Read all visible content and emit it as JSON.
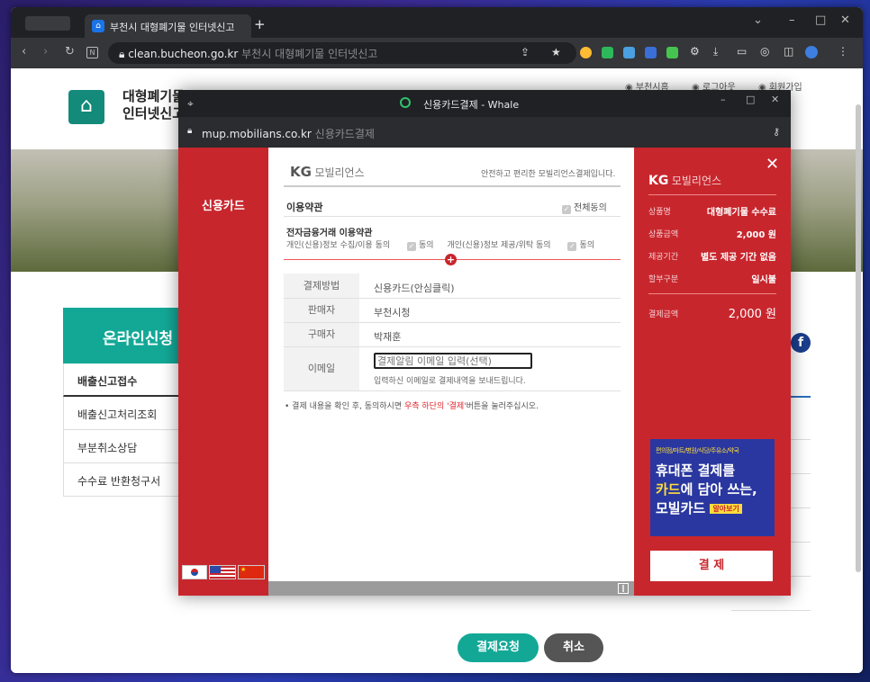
{
  "browser": {
    "tab_title": "부천시 대형폐기물 인터넷신고",
    "new_tab": "+",
    "url_host": "clean.bucheon.go.kr",
    "url_title": "부천시 대형폐기물 인터넷신고"
  },
  "site": {
    "logo_line1": "대형폐기물",
    "logo_line2": "인터넷신고",
    "header_links": [
      "부천시홈",
      "로그아웃",
      "회원가입"
    ],
    "sidebar_title": "온라인신청",
    "sidebar_items": [
      "배출신고접수",
      "배출신고처리조회",
      "부분취소상담",
      "수수료 반환청구서"
    ],
    "btn_pay_request": "결제요청",
    "btn_cancel": "취소"
  },
  "popup": {
    "window_title": "신용카드결제 - Whale",
    "url_host": "mup.mobilians.co.kr",
    "url_title": "신용카드결제",
    "left_menu": "신용카드",
    "brand": "모빌리언스",
    "brand_kg": "KG",
    "slogan": "안전하고 편리한 모빌리언스결제입니다.",
    "terms_title": "이용약관",
    "agree_all": "전체동의",
    "ef_terms": "전자금융거래 이용약관",
    "privacy_collect": "개인(신용)정보 수집/이용 동의",
    "privacy_provide": "개인(신용)정보 제공/위탁 동의",
    "agree": "동의",
    "rows": [
      {
        "label": "결제방법",
        "value": "신용카드(안심클릭)"
      },
      {
        "label": "판매자",
        "value": "부천시청"
      },
      {
        "label": "구매자",
        "value": "박재훈"
      }
    ],
    "email_label": "이메일",
    "email_placeholder": "결제알림 이메일 입력(선택)",
    "email_help": "입력하신 이메일로 결제내역을 보내드립니다.",
    "notice_pre": "• 결제 내용을 확인 후, 동의하시면 ",
    "notice_red": "우측 하단의 '결제'",
    "notice_post": "버튼을 눌러주십시오.",
    "summary": [
      {
        "label": "상품명",
        "value": "대형폐기물 수수료"
      },
      {
        "label": "상품금액",
        "value": "2,000 원"
      },
      {
        "label": "제공기간",
        "value": "별도 제공 기간 없음"
      },
      {
        "label": "할부구분",
        "value": "일시불"
      }
    ],
    "total_label": "결제금액",
    "total_value": "2,000 원",
    "ad_small": "편의점/마트/병원/식당/주유소/약국",
    "ad_line1": "휴대폰 결제를",
    "ad_line2_a": "카드",
    "ad_line2_b": "에 담아 쓰는,",
    "ad_line3": "모빌카드",
    "ad_more": "알아보기",
    "pay_button": "결 제"
  },
  "colors": {
    "popup_red": "#c8262d",
    "site_teal": "#13a896",
    "pay_request": "#13a896",
    "cancel": "#555555"
  }
}
